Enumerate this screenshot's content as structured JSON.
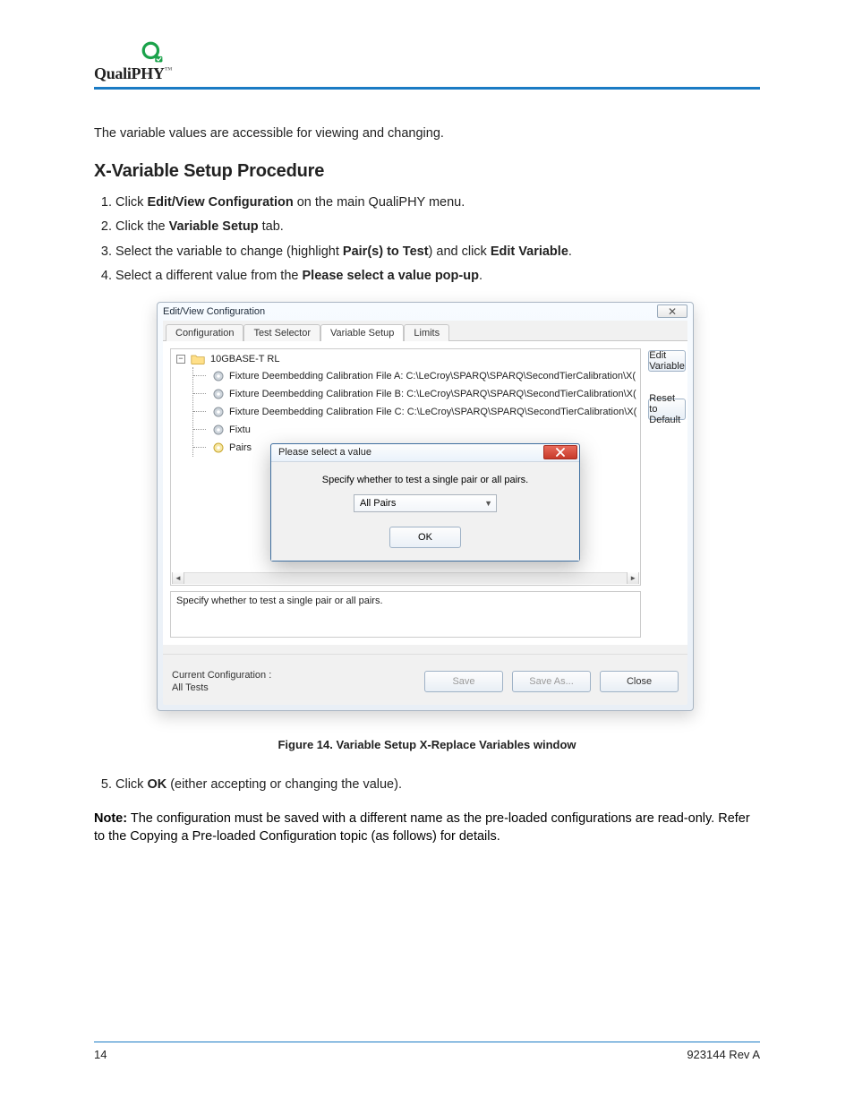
{
  "logo": {
    "text": "QualiPHY",
    "tm": "™"
  },
  "intro": "The variable values are accessible for viewing and changing.",
  "section_title": "X-Variable Setup Procedure",
  "steps": [
    {
      "pre": "Click ",
      "bold": "Edit/View Configuration",
      "post": " on the main QualiPHY menu."
    },
    {
      "pre": "Click the ",
      "bold": "Variable Setup",
      "post": " tab."
    },
    {
      "pre": "Select the variable to change (highlight ",
      "boldA": "Pair(s) to Test",
      "mid": ") and click ",
      "boldB": "Edit Variable",
      "post": "."
    },
    {
      "pre": "Select a different value from the ",
      "bold": "Please select a value pop-up",
      "post": "."
    }
  ],
  "window": {
    "title": "Edit/View Configuration",
    "close_glyph": "✕",
    "tabs": [
      {
        "label": "Configuration"
      },
      {
        "label": "Test Selector"
      },
      {
        "label": "Variable Setup"
      },
      {
        "label": "Limits"
      }
    ],
    "buttons": {
      "edit_variable": "Edit Variable",
      "reset_default": "Reset to Default",
      "save": "Save",
      "save_as": "Save As...",
      "close": "Close"
    },
    "tree": {
      "root": "10GBASE-T RL",
      "items": [
        "Fixture Deembedding Calibration File A: C:\\LeCroy\\SPARQ\\SPARQ\\SecondTierCalibration\\X(",
        "Fixture Deembedding Calibration File B: C:\\LeCroy\\SPARQ\\SPARQ\\SecondTierCalibration\\X(",
        "Fixture Deembedding Calibration File C: C:\\LeCroy\\SPARQ\\SPARQ\\SecondTierCalibration\\X(",
        "Fixtu",
        "Pairs"
      ]
    },
    "description": "Specify whether to test a single pair or all pairs.",
    "current_config_label": "Current Configuration :",
    "current_config_value": "All Tests"
  },
  "modal": {
    "title": "Please select a value",
    "prompt": "Specify whether to test a single pair or all pairs.",
    "selected": "All Pairs",
    "ok": "OK"
  },
  "figure_caption": "Figure 14. Variable Setup X-Replace Variables window",
  "followup_5": {
    "pre": "Click ",
    "bold": "OK",
    "post": " (either accepting or changing the value)."
  },
  "note": {
    "label": "Note:",
    "text": "The configuration must be saved with a different name as the pre-loaded configurations are read-only. Refer to the Copying a Pre-loaded Configuration topic (as follows) for details."
  },
  "footer": {
    "page": "14",
    "rev": "923144 Rev A"
  }
}
